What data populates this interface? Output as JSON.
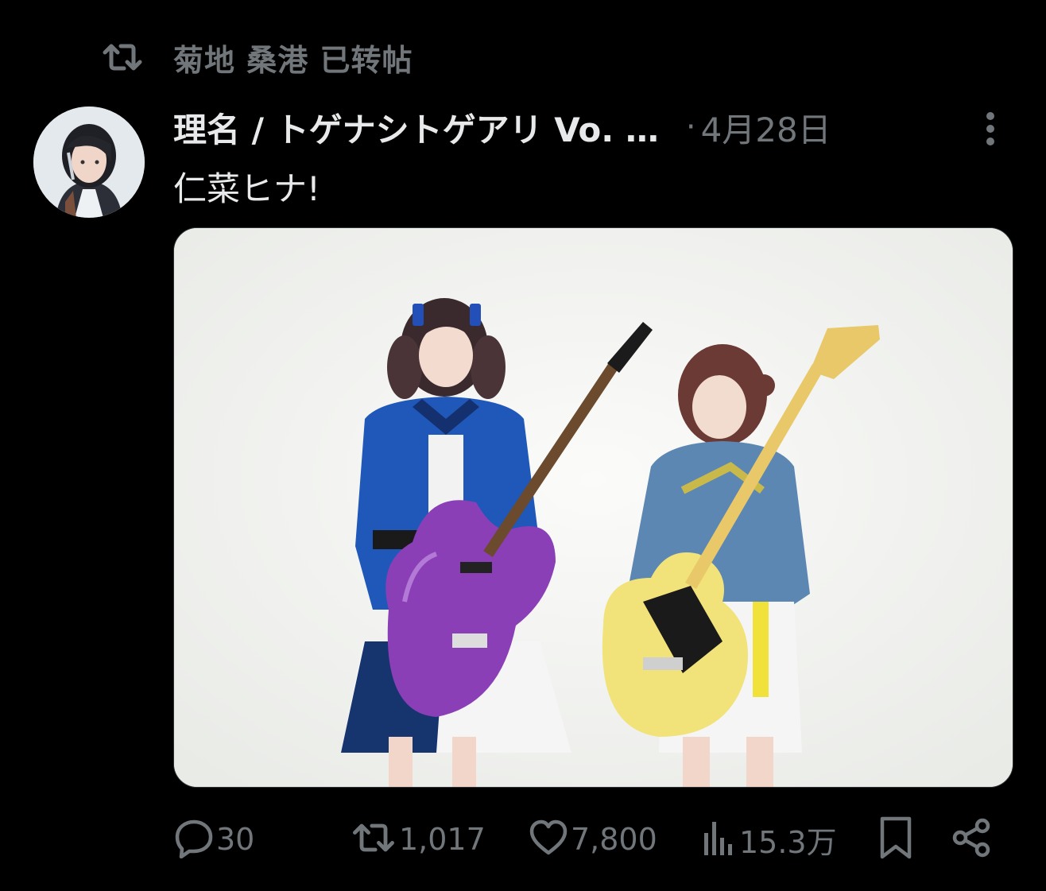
{
  "retweet_header": {
    "icon": "retweet-icon",
    "text": "菊地 桑港 已转帖"
  },
  "tweet": {
    "author": {
      "display_name": "理名 / トゲナシトゲアリ Vo. …",
      "avatar": "avatar-photo"
    },
    "separator": "·",
    "date": "4月28日",
    "text": "仁菜ヒナ!",
    "media": {
      "description": "two-musicians-with-guitars-photo"
    }
  },
  "actions": {
    "reply": {
      "icon": "reply-icon",
      "count": "30"
    },
    "retweet": {
      "icon": "retweet-icon",
      "count": "1,017"
    },
    "like": {
      "icon": "heart-icon",
      "count": "7,800"
    },
    "views": {
      "icon": "views-icon",
      "count": "15.3万"
    },
    "bookmark": {
      "icon": "bookmark-icon"
    },
    "share": {
      "icon": "share-icon"
    }
  },
  "colors": {
    "background": "#000000",
    "text": "#e7e9ea",
    "muted": "#71767b"
  }
}
